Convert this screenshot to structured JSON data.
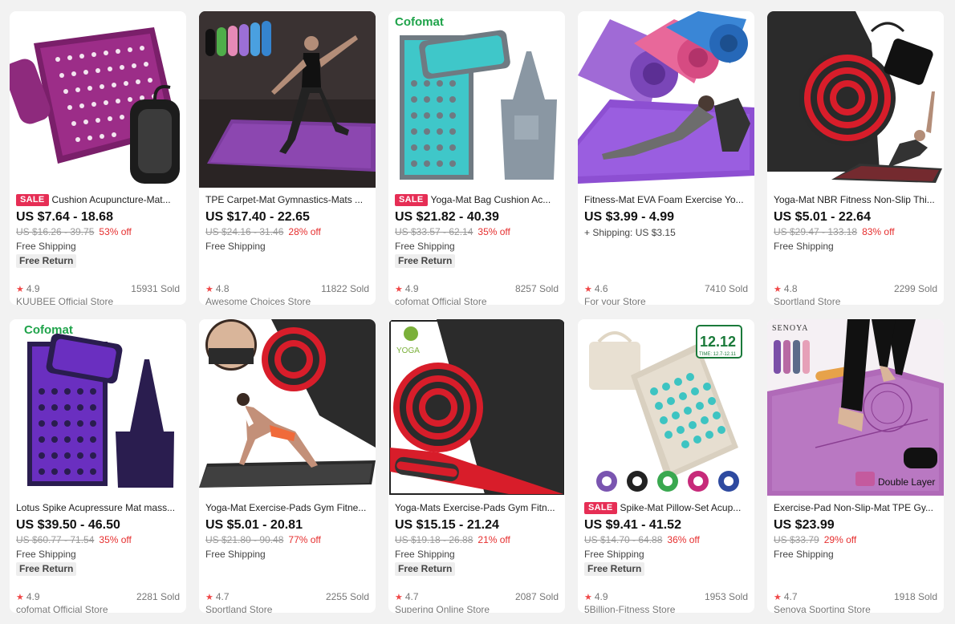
{
  "products": [
    {
      "sale": "SALE",
      "title": "Cushion Acupuncture-Mat...",
      "price": "US $7.64 - 18.68",
      "original_price": "US $16.26 - 39.75",
      "discount": "53% off",
      "shipping": "Free Shipping",
      "free_return": "Free Return",
      "rating": "4.9",
      "sold": "15931 Sold",
      "store": "KUUBEE Official Store"
    },
    {
      "sale": "",
      "title": "TPE Carpet-Mat Gymnastics-Mats ...",
      "price": "US $17.40 - 22.65",
      "original_price": "US $24.16 - 31.46",
      "discount": "28% off",
      "shipping": "Free Shipping",
      "free_return": "",
      "rating": "4.8",
      "sold": "11822 Sold",
      "store": "Awesome Choices Store"
    },
    {
      "sale": "SALE",
      "title": "Yoga-Mat Bag Cushion Ac...",
      "price": "US $21.82 - 40.39",
      "original_price": "US $33.57 - 62.14",
      "discount": "35% off",
      "shipping": "Free Shipping",
      "free_return": "Free Return",
      "rating": "4.9",
      "sold": "8257 Sold",
      "store": "cofomat Official Store",
      "brand": "Cofomat"
    },
    {
      "sale": "",
      "title": "Fitness-Mat EVA Foam Exercise Yo...",
      "price": "US $3.99 - 4.99",
      "original_price": "",
      "discount": "",
      "shipping": "+ Shipping: US $3.15",
      "free_return": "",
      "rating": "4.6",
      "sold": "7410 Sold",
      "store": "For your Store"
    },
    {
      "sale": "",
      "title": "Yoga-Mat NBR Fitness Non-Slip Thi...",
      "price": "US $5.01 - 22.64",
      "original_price": "US $29.47 - 133.18",
      "discount": "83% off",
      "shipping": "Free Shipping",
      "free_return": "",
      "rating": "4.8",
      "sold": "2299 Sold",
      "store": "Sportland Store"
    },
    {
      "sale": "",
      "title": "Lotus Spike Acupressure Mat mass...",
      "price": "US $39.50 - 46.50",
      "original_price": "US $60.77 - 71.54",
      "discount": "35% off",
      "shipping": "Free Shipping",
      "free_return": "Free Return",
      "rating": "4.9",
      "sold": "2281 Sold",
      "store": "cofomat Official Store",
      "brand": "Cofomat"
    },
    {
      "sale": "",
      "title": "Yoga-Mat Exercise-Pads Gym Fitne...",
      "price": "US $5.01 - 20.81",
      "original_price": "US $21.80 - 90.48",
      "discount": "77% off",
      "shipping": "Free Shipping",
      "free_return": "",
      "rating": "4.7",
      "sold": "2255 Sold",
      "store": "Sportland Store"
    },
    {
      "sale": "",
      "title": "Yoga-Mats Exercise-Pads Gym Fitn...",
      "price": "US $15.15 - 21.24",
      "original_price": "US $19.18 - 26.88",
      "discount": "21% off",
      "shipping": "Free Shipping",
      "free_return": "Free Return",
      "rating": "4.7",
      "sold": "2087 Sold",
      "store": "Supering Online Store",
      "brand": "YOGA"
    },
    {
      "sale": "SALE",
      "title": "Spike-Mat Pillow-Set Acup...",
      "price": "US $9.41 - 41.52",
      "original_price": "US $14.70 - 64.88",
      "discount": "36% off",
      "shipping": "Free Shipping",
      "free_return": "Free Return",
      "rating": "4.9",
      "sold": "1953 Sold",
      "store": "5Billion-Fitness Store",
      "promo_badge": "12.12",
      "promo_dates": "TIME: 12.7-12.11"
    },
    {
      "sale": "",
      "title": "Exercise-Pad Non-Slip-Mat TPE Gy...",
      "price": "US $23.99",
      "original_price": "US $33.79",
      "discount": "29% off",
      "shipping": "Free Shipping",
      "free_return": "",
      "rating": "4.7",
      "sold": "1918 Sold",
      "store": "Senoya Sporting Store",
      "brand": "SENOYA",
      "overlay_label": "Double Layer"
    }
  ],
  "icons": {
    "rating": "star-icon"
  },
  "colors": {
    "sale_badge": "#e62e55",
    "discount": "#e62e2e",
    "star": "#f04848"
  }
}
